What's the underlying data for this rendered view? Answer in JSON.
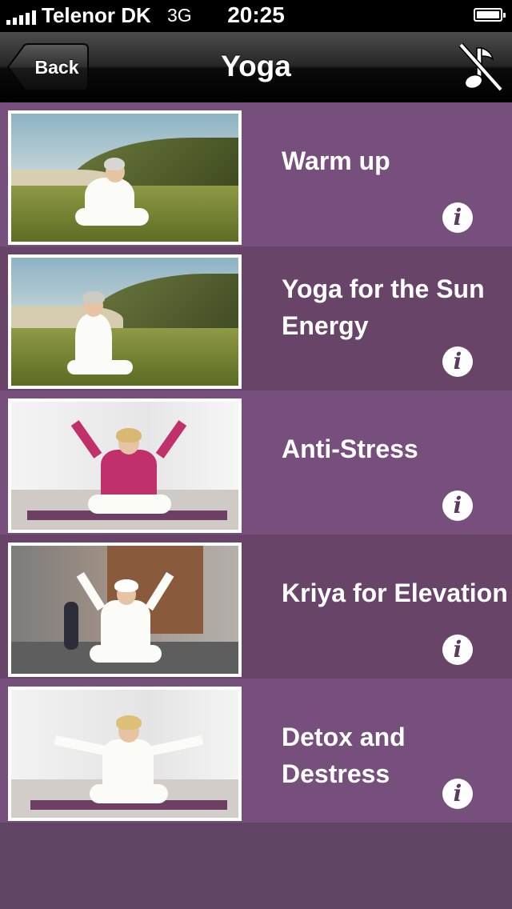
{
  "status_bar": {
    "carrier": "Telenor DK",
    "network": "3G",
    "time": "20:25",
    "signal_bars": 5,
    "battery_level": 1.0
  },
  "nav": {
    "back_label": "Back",
    "title": "Yoga",
    "music_toggle_icon": "music-off-icon"
  },
  "items": [
    {
      "title": "Warm up",
      "image": "woman in white sitting on a grassy dune by the sea",
      "info_icon": "info-icon"
    },
    {
      "title": "Yoga for the Sun Energy",
      "image": "woman in white sitting on grass by the sea, hands raised",
      "info_icon": "info-icon"
    },
    {
      "title": "Anti-Stress",
      "image": "woman in pink cardigan on yoga mat, arms raised",
      "info_icon": "info-icon"
    },
    {
      "title": "Kriya for Elevation",
      "image": "man in white on city street, arms raised in a V",
      "info_icon": "info-icon"
    },
    {
      "title": "Detox and Destress",
      "image": "woman in white on yoga mat, arms outstretched",
      "info_icon": "info-icon"
    }
  ],
  "colors": {
    "row_light": "#774f7c",
    "row_dark": "#684568",
    "background": "#5f4463",
    "info_glyph": "#5c3a60"
  }
}
